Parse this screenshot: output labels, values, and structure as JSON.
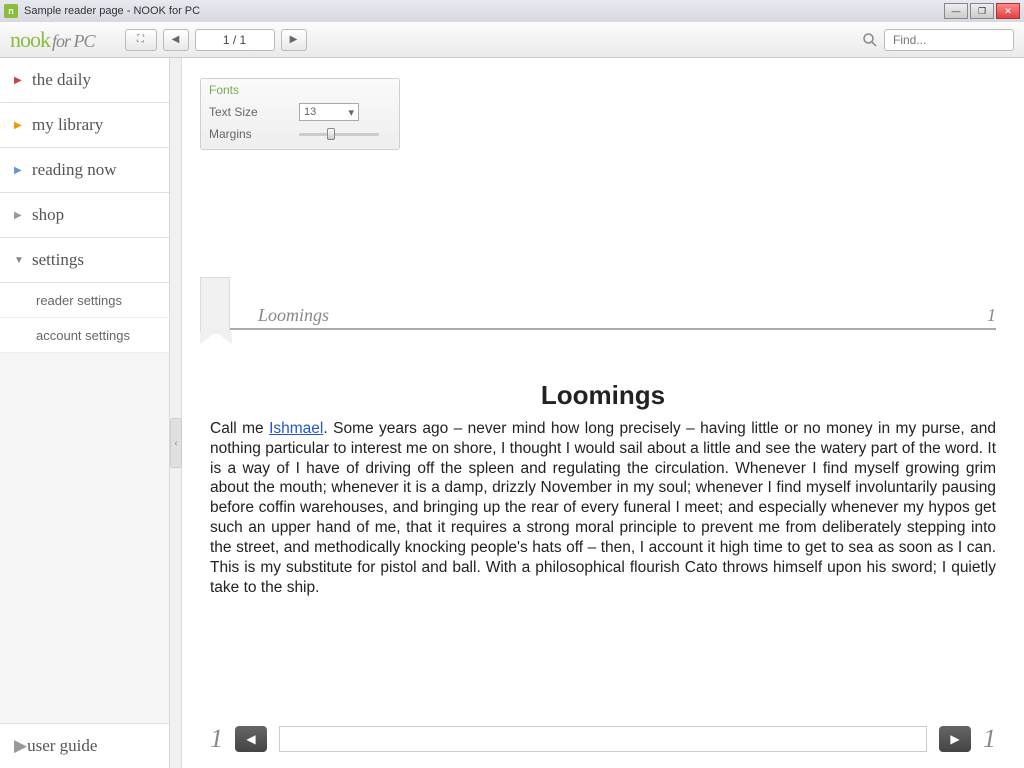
{
  "titlebar": {
    "title": "Sample reader page - NOOK for PC"
  },
  "logo": {
    "brand": "nook",
    "suffix": "for PC"
  },
  "toolbar": {
    "page_indicator": "1 / 1",
    "search_placeholder": "Find..."
  },
  "sidebar": {
    "items": [
      {
        "label": "the daily",
        "caret": "red"
      },
      {
        "label": "my library",
        "caret": "orange"
      },
      {
        "label": "reading now",
        "caret": "blue"
      },
      {
        "label": "shop",
        "caret": "gray"
      },
      {
        "label": "settings",
        "caret": "down"
      }
    ],
    "subitems": [
      {
        "label": "reader settings"
      },
      {
        "label": "account settings"
      }
    ],
    "bottom": {
      "label": "user guide"
    }
  },
  "fonts_panel": {
    "title": "Fonts",
    "text_size_label": "Text Size",
    "text_size_value": "13",
    "margins_label": "Margins"
  },
  "page": {
    "header_title": "Loomings",
    "header_page": "1",
    "chapter_title": "Loomings",
    "body_prefix": "Call me ",
    "body_link": "Ishmael",
    "body_rest": ". Some years ago – never mind how long precisely – having little or no money in my purse, and nothing particular to interest me on shore, I thought I would sail about a little and see the watery part of the word. It is a way of I have of driving off the spleen and regulating the circulation. Whenever I find myself growing grim about the mouth; whenever it is a damp, drizzly November in my soul; whenever I find myself involuntarily pausing before coffin warehouses, and bringing up the rear of every funeral I meet; and especially whenever my hypos get such an upper hand of me, that it requires a strong moral principle to prevent me from deliberately stepping into the street, and methodically knocking people's hats off – then, I account it high time to get to sea as soon as I can. This is my substitute for pistol and ball. With a philosophical flourish Cato throws himself upon his sword; I quietly take to the ship."
  },
  "footer": {
    "left_page": "1",
    "right_page": "1"
  }
}
